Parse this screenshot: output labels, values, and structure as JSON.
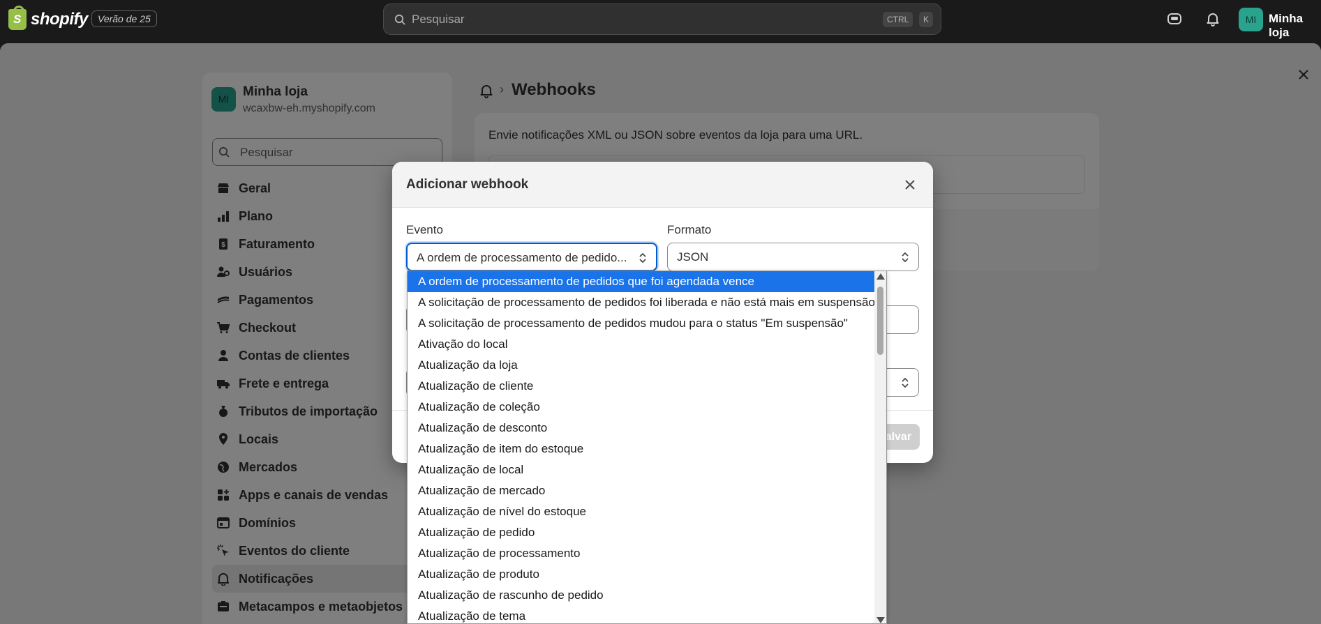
{
  "topbar": {
    "brand": "shopify",
    "badge": "Verão de 25",
    "search_placeholder": "Pesquisar",
    "shortcut_ctrl": "CTRL",
    "shortcut_key": "K",
    "avatar_initials": "MI",
    "store_name": "Minha loja"
  },
  "sidebar": {
    "avatar_initials": "MI",
    "store_name": "Minha loja",
    "store_domain": "wcaxbw-eh.myshopify.com",
    "search_placeholder": "Pesquisar",
    "items": [
      {
        "label": "Geral",
        "icon": "store-icon"
      },
      {
        "label": "Plano",
        "icon": "plan-icon"
      },
      {
        "label": "Faturamento",
        "icon": "billing-icon"
      },
      {
        "label": "Usuários",
        "icon": "users-icon"
      },
      {
        "label": "Pagamentos",
        "icon": "payments-icon"
      },
      {
        "label": "Checkout",
        "icon": "cart-icon"
      },
      {
        "label": "Contas de clientes",
        "icon": "person-icon"
      },
      {
        "label": "Frete e entrega",
        "icon": "truck-icon"
      },
      {
        "label": "Tributos de importação",
        "icon": "duties-icon"
      },
      {
        "label": "Locais",
        "icon": "location-icon"
      },
      {
        "label": "Mercados",
        "icon": "globe-icon"
      },
      {
        "label": "Apps e canais de vendas",
        "icon": "apps-icon"
      },
      {
        "label": "Domínios",
        "icon": "domains-icon"
      },
      {
        "label": "Eventos do cliente",
        "icon": "cursor-icon"
      },
      {
        "label": "Notificações",
        "icon": "bell-icon",
        "active": true
      },
      {
        "label": "Metacampos e metaobjetos",
        "icon": "metafields-icon"
      }
    ]
  },
  "main": {
    "page_title": "Webhooks",
    "description": "Envie notificações XML ou JSON sobre eventos da loja para uma URL."
  },
  "modal": {
    "title": "Adicionar webhook",
    "event_label": "Evento",
    "event_value": "A ordem de processamento de pedido...",
    "format_label": "Formato",
    "format_value": "JSON",
    "save_label": "Salvar"
  },
  "dropdown": {
    "options": [
      "A ordem de processamento de pedidos que foi agendada vence",
      "A solicitação de processamento de pedidos foi liberada e não está mais em suspensão",
      "A solicitação de processamento de pedidos mudou para o status \"Em suspensão\"",
      "Ativação do local",
      "Atualização da loja",
      "Atualização de cliente",
      "Atualização de coleção",
      "Atualização de desconto",
      "Atualização de item do estoque",
      "Atualização de local",
      "Atualização de mercado",
      "Atualização de nível do estoque",
      "Atualização de pedido",
      "Atualização de processamento",
      "Atualização de produto",
      "Atualização de rascunho de pedido",
      "Atualização de tema"
    ],
    "selected_index": 0
  },
  "colors": {
    "accent": "#005bd3",
    "selected_option": "#1a73e8",
    "topbar": "#1a1a1a",
    "avatar": "#29a38e"
  }
}
